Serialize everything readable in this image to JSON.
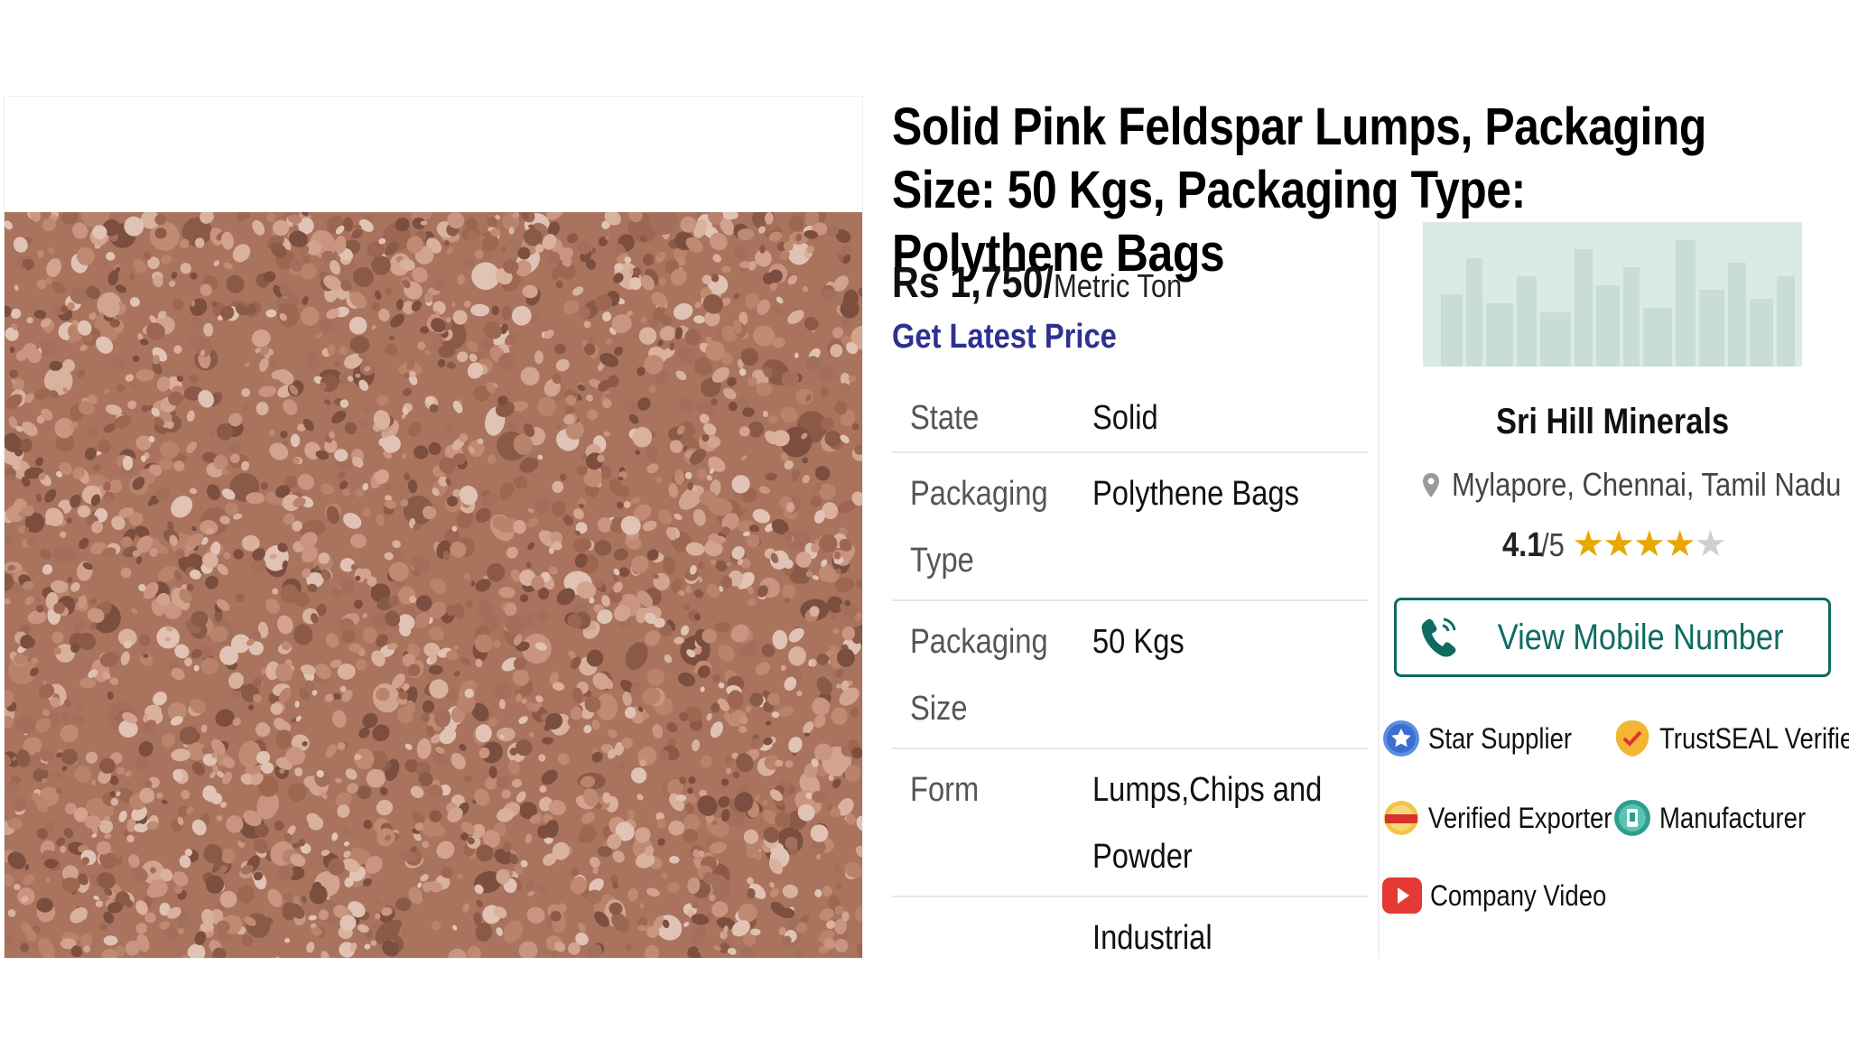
{
  "product": {
    "title": "Solid Pink Feldspar Lumps, Packaging Size: 50 Kgs, Packaging Type: Polythene Bags",
    "price_amount": "Rs 1,750/",
    "price_unit": "Metric Ton",
    "latest_price_link": "Get Latest Price",
    "image_icon": "pink-feldspar-stones-photo"
  },
  "specs": [
    {
      "key": "State",
      "value": "Solid"
    },
    {
      "key": "Packaging Type",
      "value": "Polythene Bags"
    },
    {
      "key": "Packaging Size",
      "value": "50 Kgs"
    },
    {
      "key": "Form",
      "value": "Lumps,Chips and Powder"
    },
    {
      "key": "",
      "value": "Industrial"
    }
  ],
  "seller": {
    "name": "Sri Hill Minerals",
    "location": "Mylapore, Chennai, Tamil Nadu",
    "rating_value": "4.1",
    "rating_max": "/5",
    "rating_stars": 4.1,
    "mobile_button": "View Mobile Number",
    "badges": {
      "star_supplier": "Star Supplier",
      "trustseal": "TrustSEAL Verified",
      "verified_exporter": "Verified Exporter",
      "manufacturer": "Manufacturer",
      "company_video": "Company Video"
    }
  },
  "colors": {
    "link_blue": "#2e3192",
    "brand_teal": "#0f6b5f",
    "star_gold": "#e8a700",
    "video_red": "#e53935"
  }
}
